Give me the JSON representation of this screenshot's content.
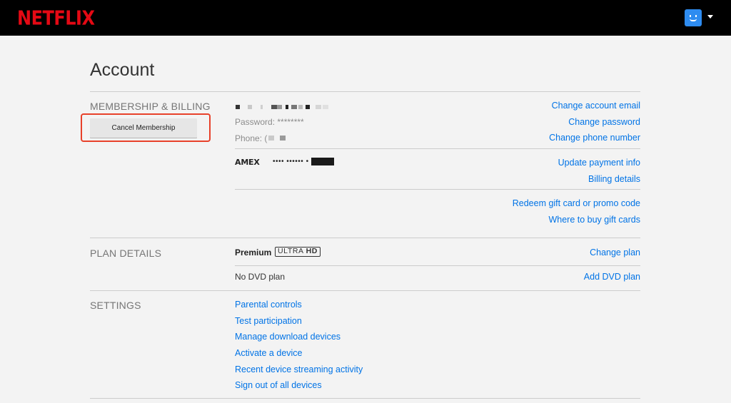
{
  "header": {
    "logo_text": "NETFLIX",
    "avatar_icon": "smiley-avatar-icon",
    "menu_icon": "caret-down-icon",
    "colors": {
      "brand": "#e50914",
      "bar": "#000000",
      "avatar": "#2e8cf0"
    }
  },
  "page": {
    "title": "Account"
  },
  "membership": {
    "label": "MEMBERSHIP & BILLING",
    "cancel_button": "Cancel Membership",
    "password": "Password: ********",
    "phone": "Phone: (",
    "links": {
      "change_email": "Change account email",
      "change_password": "Change password",
      "change_phone": "Change phone number",
      "update_payment": "Update payment info",
      "billing_details": "Billing details",
      "redeem_gift": "Redeem gift card or promo code",
      "where_to_buy": "Where to buy gift cards"
    },
    "payment": {
      "card_brand": "AMEX",
      "card_number_mask": "•••• •••••• •"
    }
  },
  "plan": {
    "label": "PLAN DETAILS",
    "plan_name": "Premium",
    "badge_part1": "ULTRA ",
    "badge_part2": "HD",
    "dvd": "No DVD plan",
    "links": {
      "change_plan": "Change plan",
      "add_dvd": "Add DVD plan"
    }
  },
  "settings": {
    "label": "SETTINGS",
    "links": [
      "Parental controls",
      "Test participation",
      "Manage download devices",
      "Activate a device",
      "Recent device streaming activity",
      "Sign out of all devices"
    ]
  },
  "colors": {
    "link": "#0073e6",
    "highlight_outline": "#e8412a"
  }
}
